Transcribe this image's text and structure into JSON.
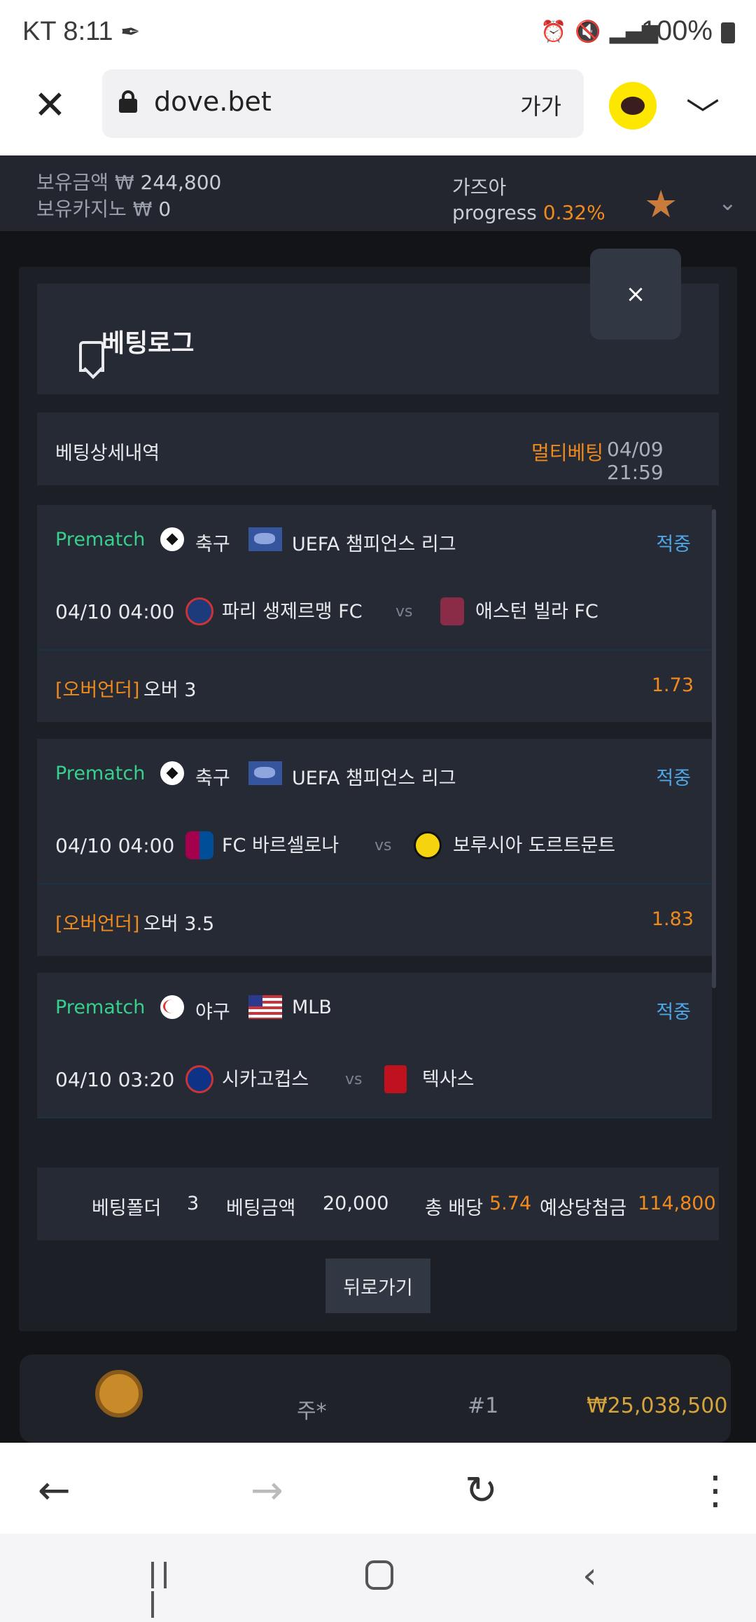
{
  "statusbar": {
    "carrier_time": "KT 8:11",
    "battery": "100%"
  },
  "browser": {
    "url": "dove.bet",
    "font_size_label": "가가"
  },
  "site": {
    "balance_label": "보유금액",
    "balance_currency": "₩",
    "balance_value": "244,800",
    "casino_label": "보유카지노",
    "casino_currency": "₩",
    "casino_value": "0",
    "username": "가즈아",
    "progress_label": "progress",
    "progress_value": "0.32%"
  },
  "modal": {
    "title": "베팅로그",
    "close_label": "×",
    "detail_label": "베팅상세내역",
    "bet_type": "멀티베팅",
    "bet_datetime": "04/09 21:59",
    "bets": [
      {
        "stage": "Prematch",
        "sport": "축구",
        "league": "UEFA 챔피언스 리그",
        "status": "적중",
        "match_time": "04/10 04:00",
        "home": "파리 생제르맹 FC",
        "vs": "vs",
        "away": "애스턴 빌라 FC",
        "market": "[오버언더]",
        "pick": "오버 3",
        "odds": "1.73"
      },
      {
        "stage": "Prematch",
        "sport": "축구",
        "league": "UEFA 챔피언스 리그",
        "status": "적중",
        "match_time": "04/10 04:00",
        "home": "FC 바르셀로나",
        "vs": "vs",
        "away": "보루시아 도르트문트",
        "market": "[오버언더]",
        "pick": "오버 3.5",
        "odds": "1.83"
      },
      {
        "stage": "Prematch",
        "sport": "야구",
        "league": "MLB",
        "status": "적중",
        "match_time": "04/10 03:20",
        "home": "시카고컵스",
        "vs": "vs",
        "away": "텍사스"
      }
    ],
    "summary": {
      "folder_label": "베팅폴더",
      "folder_value": "3",
      "amount_label": "베팅금액",
      "amount_value": "20,000",
      "odds_label": "총 배당",
      "odds_value": "5.74",
      "win_label": "예상당첨금",
      "win_value": "114,800"
    },
    "back_label": "뒤로가기"
  },
  "ranking": {
    "name": "주*",
    "rank": "#1",
    "prize": "₩25,038,500"
  },
  "colors": {
    "accent_orange": "#f08a1c",
    "prematch_green": "#37d08d",
    "status_blue": "#4ca6e8",
    "panel": "#262a34"
  }
}
